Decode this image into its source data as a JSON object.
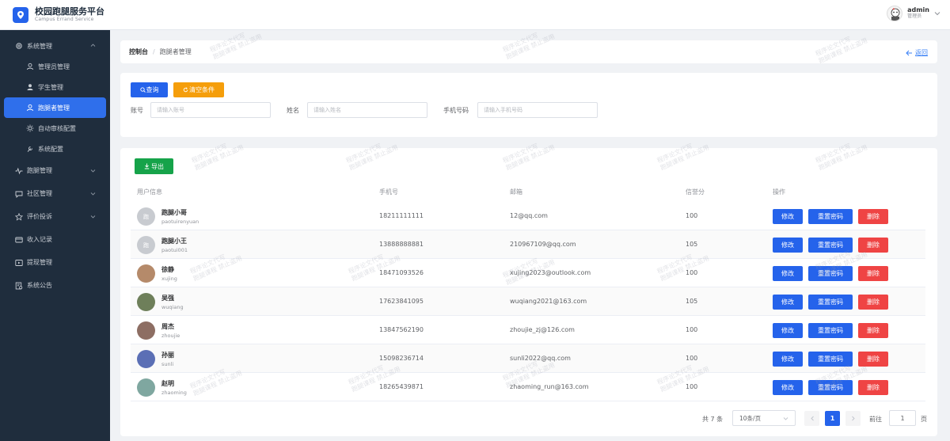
{
  "app": {
    "title": "校园跑腿服务平台",
    "subtitle": "Campus Errand Service",
    "brand_color": "#2563eb"
  },
  "user": {
    "name": "admin",
    "role": "管理员"
  },
  "sidebar": {
    "items": [
      {
        "label": "系统管理",
        "icon": "gear-icon",
        "expanded": true
      },
      {
        "label": "管理员管理",
        "icon": "user-admin-icon"
      },
      {
        "label": "学生管理",
        "icon": "user-icon"
      },
      {
        "label": "跑腿者管理",
        "icon": "user-outline-icon",
        "active": true
      },
      {
        "label": "自动审核配置",
        "icon": "sun-icon"
      },
      {
        "label": "系统配置",
        "icon": "tool-icon"
      },
      {
        "label": "跑腿管理",
        "icon": "pulse-icon"
      },
      {
        "label": "社区管理",
        "icon": "chat-icon"
      },
      {
        "label": "评价投诉",
        "icon": "star-icon"
      },
      {
        "label": "收入记录",
        "icon": "card-icon"
      },
      {
        "label": "提现管理",
        "icon": "withdraw-icon"
      },
      {
        "label": "系统公告",
        "icon": "notice-icon"
      }
    ]
  },
  "breadcrumb": {
    "root": "控制台",
    "separator": "/",
    "current": "跑腿者管理",
    "back": "返回"
  },
  "search": {
    "query_button": "查询",
    "clear_button": "清空条件",
    "account_label": "账号",
    "account_placeholder": "请输入账号",
    "name_label": "姓名",
    "name_placeholder": "请输入姓名",
    "phone_label": "手机号码",
    "phone_placeholder": "请输入手机号码"
  },
  "toolbar": {
    "export_button": "导出"
  },
  "table": {
    "columns": [
      "用户信息",
      "手机号",
      "邮箱",
      "信誉分",
      "操作"
    ],
    "actions": {
      "edit": "修改",
      "reset": "重置密码",
      "delete": "删除"
    },
    "rows": [
      {
        "name": "跑腿小哥",
        "account": "paotuirenyuan",
        "phone": "18211111111",
        "email": "12@qq.com",
        "score": "100",
        "avatar": "跑",
        "avatar_color": "#c8cbd0"
      },
      {
        "name": "跑腿小王",
        "account": "paotui001",
        "phone": "13888888881",
        "email": "210967109@qq.com",
        "score": "105",
        "avatar": "跑",
        "avatar_color": "#c8cbd0"
      },
      {
        "name": "徐静",
        "account": "xujing",
        "phone": "18471093526",
        "email": "xujing2023@outlook.com",
        "score": "100",
        "avatar": "",
        "avatar_color": "#b58a6a"
      },
      {
        "name": "吴强",
        "account": "wuqiang",
        "phone": "17623841095",
        "email": "wuqiang2021@163.com",
        "score": "105",
        "avatar": "",
        "avatar_color": "#6e7f5a"
      },
      {
        "name": "周杰",
        "account": "zhoujie",
        "phone": "13847562190",
        "email": "zhoujie_zj@126.com",
        "score": "100",
        "avatar": "",
        "avatar_color": "#8d6e63"
      },
      {
        "name": "孙丽",
        "account": "sunli",
        "phone": "15098236714",
        "email": "sunli2022@qq.com",
        "score": "100",
        "avatar": "",
        "avatar_color": "#5b6fb5"
      },
      {
        "name": "赵明",
        "account": "zhaoming",
        "phone": "18265439871",
        "email": "zhaoming_run@163.com",
        "score": "100",
        "avatar": "",
        "avatar_color": "#7fa7a0"
      }
    ]
  },
  "pagination": {
    "total": "共 7 条",
    "page_size": "10条/页",
    "current_page": "1",
    "goto_label": "前往",
    "goto_value": "1",
    "page_suffix": "页"
  },
  "watermark": {
    "line1": "程序论文代写",
    "line2": "跑腿课程 禁止盗用"
  }
}
